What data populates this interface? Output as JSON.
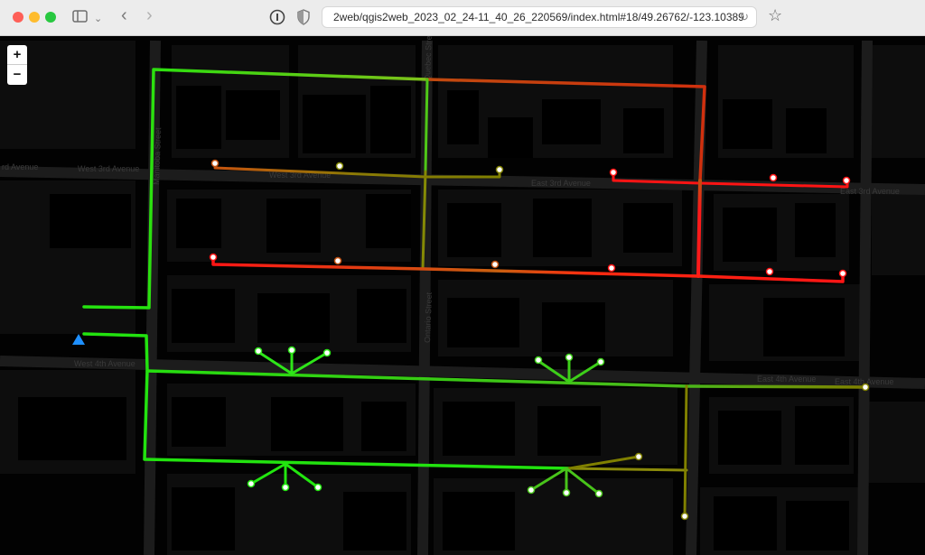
{
  "browser": {
    "url": "2web/qgis2web_2023_02_24-11_40_26_220569/index.html#18/49.26762/-123.10389",
    "sidebar_icon": "sidebar-icon",
    "back_icon": "chevron-left-icon",
    "forward_icon": "chevron-right-icon",
    "reload_icon": "reload-icon",
    "bookmark_icon": "star-icon"
  },
  "map": {
    "zoom_in_label": "+",
    "zoom_out_label": "−",
    "streets": {
      "west_3rd_a": "rd Avenue",
      "west_3rd_b": "West 3rd Avenue",
      "west_3rd_c": "West 3rd Avenue",
      "east_3rd_a": "East 3rd Avenue",
      "east_3rd_b": "East 3rd Avenue",
      "west_4th": "West 4th Avenue",
      "east_4th_a": "East 4th Avenue",
      "east_4th_b": "East 4th Avenue",
      "manitoba": "Manitoba Street",
      "ontario": "Ontario Street",
      "quebec": "Quebec Street"
    },
    "colors": {
      "green": "#2bd80f",
      "lime": "#5cc01a",
      "olive": "#808000",
      "orange": "#c85a10",
      "red": "#ff1a1a",
      "source": "#1e90ff"
    }
  }
}
